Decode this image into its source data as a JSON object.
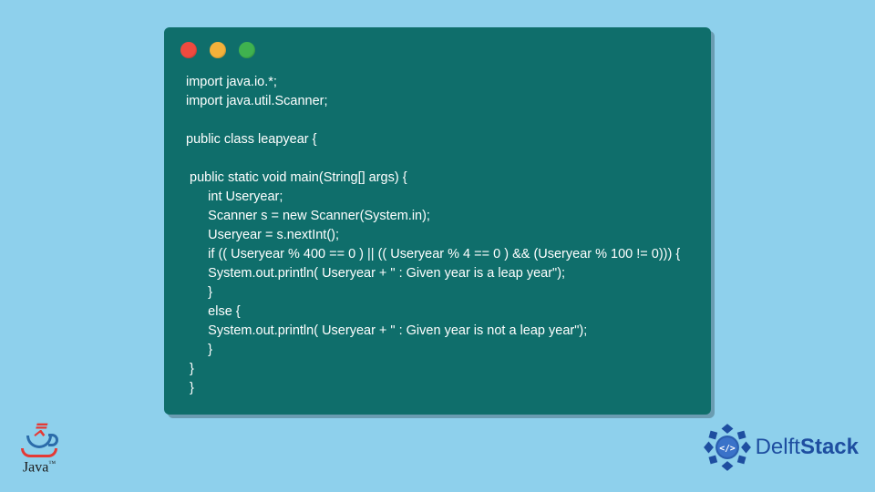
{
  "code": {
    "lines": [
      "import java.io.*;",
      "import java.util.Scanner;",
      "",
      "public class leapyear {",
      "",
      " public static void main(String[] args) {",
      "      int Useryear;",
      "      Scanner s = new Scanner(System.in);",
      "      Useryear = s.nextInt();",
      "      if (( Useryear % 400 == 0 ) || (( Useryear % 4 == 0 ) && (Useryear % 100 != 0))) {",
      "      System.out.println( Useryear + \" : Given year is a leap year\");",
      "      }",
      "      else {",
      "      System.out.println( Useryear + \" : Given year is not a leap year\");",
      "      }",
      " }",
      " }"
    ]
  },
  "logos": {
    "java_label": "Java",
    "java_tm": "™",
    "delft_prefix": "Delft",
    "delft_suffix": "Stack",
    "delft_glyph": "</>"
  },
  "traffic": {
    "red": "#ef4a3f",
    "yellow": "#f4b13a",
    "green": "#3fb24f"
  }
}
